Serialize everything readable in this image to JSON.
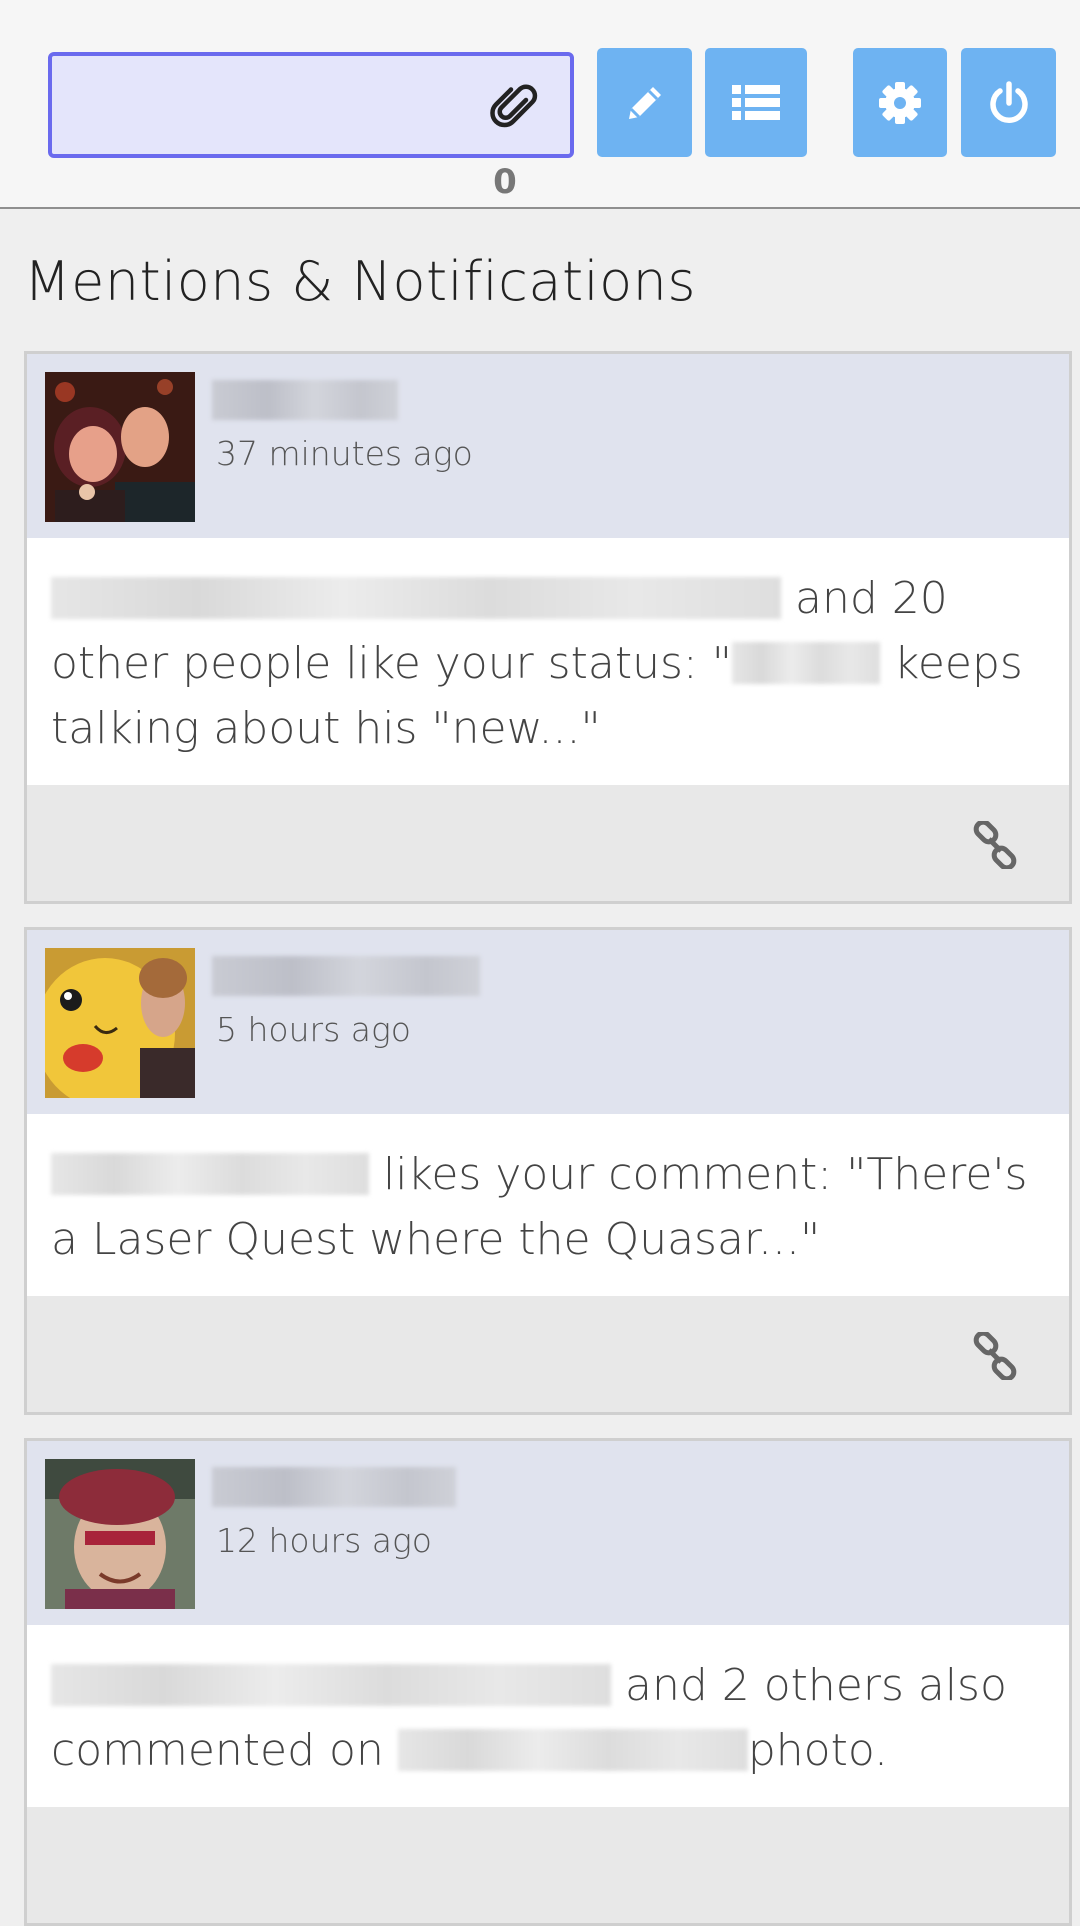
{
  "header": {
    "input_placeholder": "",
    "input_value": "",
    "char_count": "0",
    "icons": {
      "attach": "paperclip-icon",
      "compose": "pencil-icon",
      "list": "list-icon",
      "settings": "gear-icon",
      "power": "power-icon"
    },
    "accent_color": "#6eb3f2",
    "input_border_color": "#6a6aee"
  },
  "page_title": "Mentions & Notifications",
  "notifications": [
    {
      "time": "37 minutes ago",
      "text_a": "and 20 other people like your status: \"",
      "text_b": " keeps talking about his \"new...\""
    },
    {
      "time": "5 hours ago",
      "text_a": "likes your comment: \"There's a Laser Quest where the Quasar...\""
    },
    {
      "time": "12 hours ago",
      "text_a": " and 2 others also commented on ",
      "text_b": "photo."
    }
  ]
}
